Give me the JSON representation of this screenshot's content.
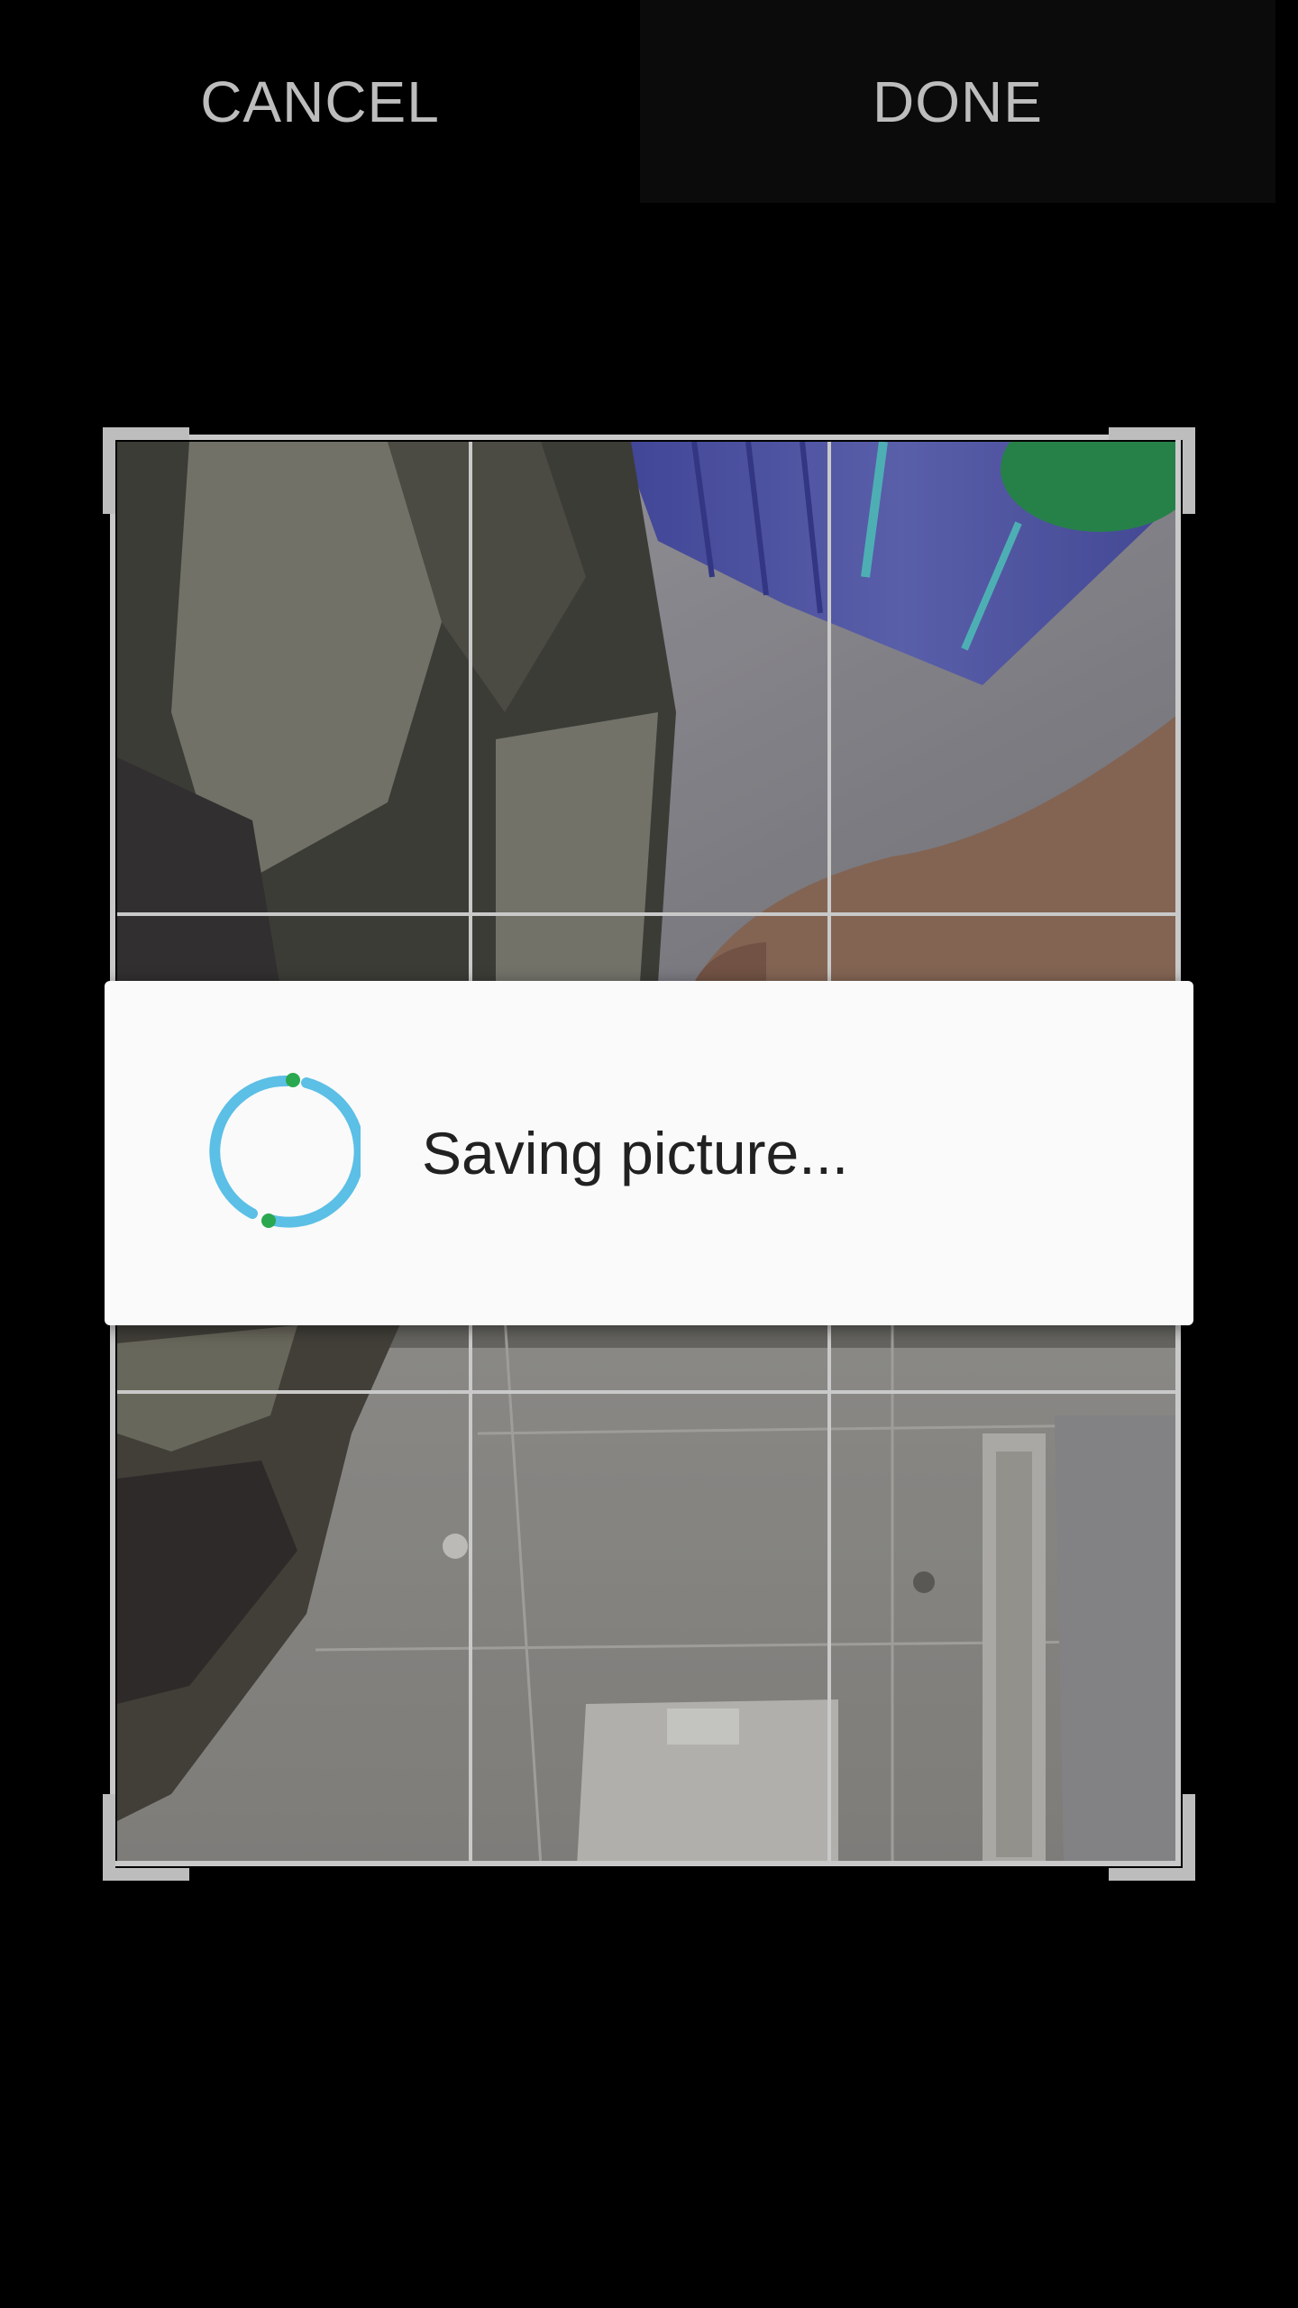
{
  "toolbar": {
    "cancel_label": "CANCEL",
    "done_label": "DONE"
  },
  "dialog": {
    "message": "Saving picture..."
  },
  "colors": {
    "background": "#000000",
    "toolbar_text": "#bdbdbd",
    "dialog_background": "#fafafa",
    "dialog_text": "#212121",
    "spinner_ring": "#5bbfe6",
    "spinner_dots": "#2aa84f",
    "crop_grid": "#c9c9c9"
  }
}
